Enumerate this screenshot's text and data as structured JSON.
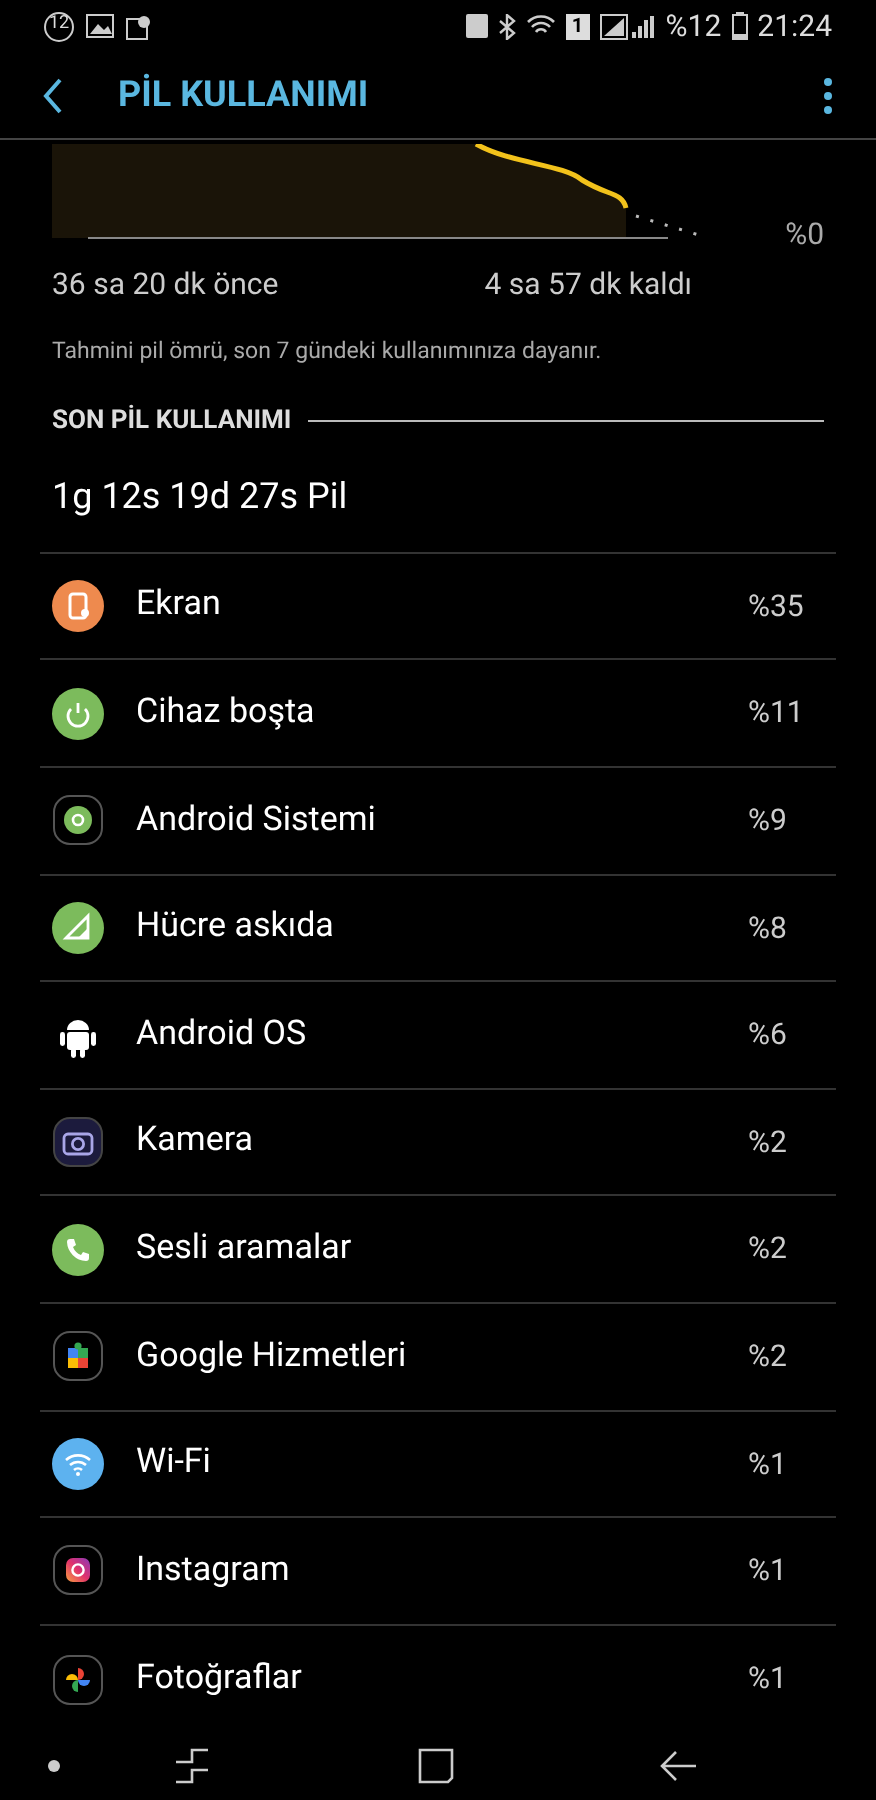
{
  "status_bar": {
    "notification_count": "12",
    "sim_slot": "1",
    "battery_text": "%12",
    "time": "21:24"
  },
  "header": {
    "title": "PİL KULLANIMI"
  },
  "graph": {
    "axis_label": "%0",
    "start_label": "36 sa 20 dk önce",
    "end_label": "4 sa 57 dk kaldı",
    "note": "Tahmini pil ömrü, son 7 gündeki kullanımınıza dayanır."
  },
  "section": {
    "title": "SON PİL KULLANIMI",
    "total": "1g 12s 19d 27s Pil"
  },
  "apps": [
    {
      "kind": "screen",
      "name": "Ekran",
      "percent": "%35"
    },
    {
      "kind": "idle",
      "name": "Cihaz boşta",
      "percent": "%11"
    },
    {
      "kind": "system",
      "name": "Android Sistemi",
      "percent": "%9"
    },
    {
      "kind": "cell",
      "name": "Hücre askıda",
      "percent": "%8"
    },
    {
      "kind": "android",
      "name": "Android OS",
      "percent": "%6"
    },
    {
      "kind": "camera",
      "name": "Kamera",
      "percent": "%2"
    },
    {
      "kind": "phone",
      "name": "Sesli aramalar",
      "percent": "%2"
    },
    {
      "kind": "puzzle",
      "name": "Google Hizmetleri",
      "percent": "%2"
    },
    {
      "kind": "wifi",
      "name": "Wi-Fi",
      "percent": "%1"
    },
    {
      "kind": "instagram",
      "name": "Instagram",
      "percent": "%1"
    },
    {
      "kind": "pinwheel",
      "name": "Fotoğraflar",
      "percent": "%1"
    }
  ]
}
